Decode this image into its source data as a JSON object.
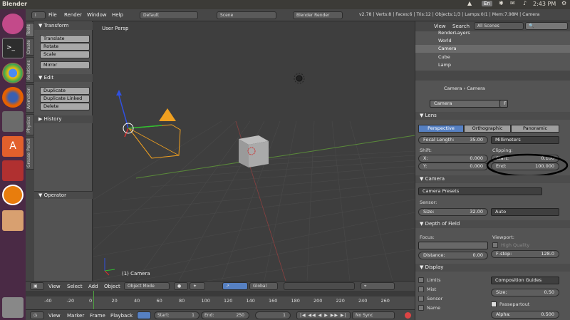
{
  "topbar": {
    "title": "Blender",
    "lang": "En",
    "time": "2:43 PM"
  },
  "header": {
    "menus": [
      "File",
      "Render",
      "Window",
      "Help"
    ],
    "screen": "Default",
    "scene": "Scene",
    "engine": "Blender Render",
    "stats": "v2.78 | Verts:8 | Faces:6 | Tris:12 | Objects:1/3 | Lamps:0/1 | Mem:7.98M | Camera"
  },
  "tool_tabs": [
    "Tools",
    "Create",
    "Relations",
    "Animation",
    "Physics",
    "Grease Pencil"
  ],
  "tools": {
    "transform_label": "Transform",
    "transform": [
      "Translate",
      "Rotate",
      "Scale"
    ],
    "mirror": "Mirror",
    "edit_label": "Edit",
    "edit": [
      "Duplicate",
      "Duplicate Linked",
      "Delete"
    ],
    "history_label": "History",
    "operator_label": "Operator"
  },
  "viewport": {
    "persp": "User Persp",
    "object": "(1) Camera"
  },
  "view_toolbar": {
    "menus": [
      "View",
      "Select",
      "Add",
      "Object"
    ],
    "mode": "Object Mode",
    "orientation": "Global"
  },
  "timeline": {
    "ticks": [
      "-40",
      "-20",
      "0",
      "20",
      "40",
      "60",
      "80",
      "100",
      "120",
      "140",
      "160",
      "180",
      "200",
      "220",
      "240",
      "260"
    ]
  },
  "timeline_bar": {
    "menus": [
      "View",
      "Marker",
      "Frame",
      "Playback"
    ],
    "start_label": "Start:",
    "start": "1",
    "end_label": "End:",
    "end": "250",
    "current": "1",
    "sync": "No Sync"
  },
  "outliner": {
    "menus": [
      "View",
      "Search"
    ],
    "filter": "All Scenes",
    "items": [
      "RenderLayers",
      "World",
      "Camera",
      "Cube",
      "Lamp"
    ]
  },
  "props": {
    "breadcrumb": [
      "Camera",
      "Camera"
    ],
    "datablock": "Camera",
    "datablock_flag": "F",
    "lens_label": "Lens",
    "lens_types": [
      "Perspective",
      "Orthographic",
      "Panoramic"
    ],
    "focal_label": "Focal Length:",
    "focal": "35.00",
    "units": "Millimeters",
    "shift_label": "Shift:",
    "shift_x_label": "X:",
    "shift_x": "0.000",
    "shift_y_label": "Y:",
    "shift_y": "0.000",
    "clip_label": "Clipping:",
    "clip_start_label": "Start:",
    "clip_start": "0.100",
    "clip_end_label": "End:",
    "clip_end": "100.000",
    "camera_label": "Camera",
    "presets": "Camera Presets",
    "sensor_label": "Sensor:",
    "size_label": "Size:",
    "size": "32.00",
    "fit": "Auto",
    "dof_label": "Depth of Field",
    "focus_label": "Focus:",
    "distance_label": "Distance:",
    "distance": "0.00",
    "viewport_label": "Viewport:",
    "hq_label": "High Quality",
    "fstop_label": "F-stop:",
    "fstop": "128.0",
    "display_label": "Display",
    "display_checks": [
      "Limits",
      "Mist",
      "Sensor",
      "Name"
    ],
    "guides": "Composition Guides",
    "disp_size_label": "Size:",
    "disp_size": "0.50",
    "passepartout_label": "Passepartout",
    "alpha_label": "Alpha:",
    "alpha": "0.500"
  }
}
